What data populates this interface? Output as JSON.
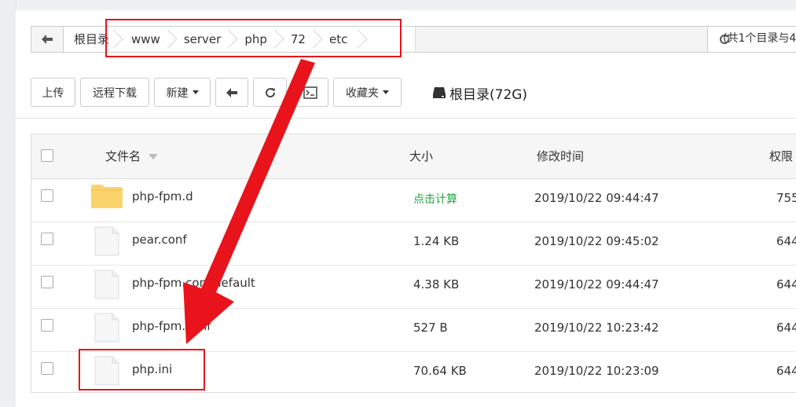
{
  "breadcrumb": {
    "items": [
      "根目录",
      "www",
      "server",
      "php",
      "72",
      "etc"
    ],
    "summary": "(共1个目录与4"
  },
  "toolbar": {
    "upload": "上传",
    "remote_download": "远程下载",
    "new": "新建",
    "favorites": "收藏夹",
    "disk_label": "根目录(72G)"
  },
  "table": {
    "headers": {
      "name": "文件名",
      "size": "大小",
      "modified": "修改时间",
      "permission": "权限"
    },
    "rows": [
      {
        "type": "folder",
        "name": "php-fpm.d",
        "size": "点击计算",
        "modified": "2019/10/22 09:44:47",
        "permission": "755"
      },
      {
        "type": "file",
        "name": "pear.conf",
        "size": "1.24 KB",
        "modified": "2019/10/22 09:45:02",
        "permission": "644"
      },
      {
        "type": "file",
        "name": "php-fpm.conf.default",
        "size": "4.38 KB",
        "modified": "2019/10/22 09:44:47",
        "permission": "644"
      },
      {
        "type": "file",
        "name": "php-fpm.conf",
        "size": "527 B",
        "modified": "2019/10/22 10:23:42",
        "permission": "644"
      },
      {
        "type": "file",
        "name": "php.ini",
        "size": "70.64 KB",
        "modified": "2019/10/22 10:23:09",
        "permission": "644"
      }
    ]
  },
  "colors": {
    "annotation": "#e8131b",
    "link_green": "#20a53a",
    "folder_yellow": "#fbd36b"
  },
  "icons": [
    "back-arrow-icon",
    "refresh-icon",
    "terminal-icon",
    "disk-icon",
    "sort-caret-icon",
    "folder-icon",
    "file-icon"
  ]
}
